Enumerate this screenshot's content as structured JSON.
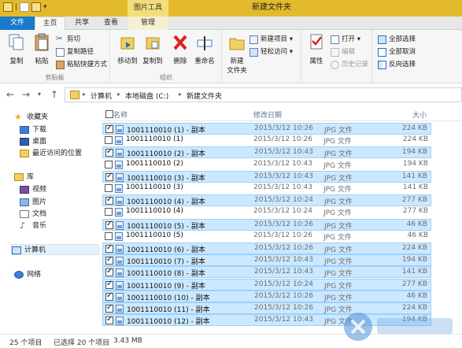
{
  "window": {
    "title": "新建文件夹",
    "context_tab_group": "图片工具"
  },
  "tabs": [
    {
      "label": "文件"
    },
    {
      "label": "主页"
    },
    {
      "label": "共享"
    },
    {
      "label": "查看"
    },
    {
      "label": "管理"
    }
  ],
  "ribbon": {
    "clipboard": {
      "label": "剪贴板",
      "copy": "复制",
      "paste": "粘贴",
      "cut": "剪切",
      "copy_path": "复制路径",
      "paste_shortcut": "粘贴快捷方式"
    },
    "organize": {
      "label": "组织",
      "move_to": "移动到",
      "copy_to": "复制到",
      "delete": "删除",
      "rename": "重命名"
    },
    "new": {
      "new_folder_line1": "新建",
      "new_folder_line2": "文件夹",
      "new_item": "新建项目 ▾",
      "easy_access": "轻松访问 ▾"
    },
    "open": {
      "properties": "属性",
      "open": "打开 ▾",
      "edit": "编辑",
      "history": "历史记录"
    },
    "select": {
      "select_all": "全部选择",
      "select_none": "全部取消",
      "invert": "反向选择"
    }
  },
  "address": {
    "crumbs": [
      "计算机",
      "本地磁盘 (C:)",
      "新建文件夹"
    ]
  },
  "nav": {
    "favorites": "收藏夹",
    "downloads": "下载",
    "desktop": "桌面",
    "recent": "最近访问的位置",
    "libraries": "库",
    "videos": "视频",
    "pictures": "图片",
    "documents": "文档",
    "music": "音乐",
    "computer": "计算机",
    "network": "网络"
  },
  "columns": {
    "name": "名称",
    "date": "修改日期",
    "size": "大小"
  },
  "files": [
    {
      "name": "1001110010 (1) - 副本",
      "date": "2015/3/12 10:26",
      "type": "JPG 文件",
      "size": "224 KB",
      "selected": true
    },
    {
      "name": "1001110010 (1)",
      "date": "2015/3/12 10:26",
      "type": "JPG 文件",
      "size": "224 KB",
      "selected": false
    },
    {
      "name": "1001110010 (2) - 副本",
      "date": "2015/3/12 10:43",
      "type": "JPG 文件",
      "size": "194 KB",
      "selected": true
    },
    {
      "name": "1001110010 (2)",
      "date": "2015/3/12 10:43",
      "type": "JPG 文件",
      "size": "194 KB",
      "selected": false
    },
    {
      "name": "1001110010 (3) - 副本",
      "date": "2015/3/12 10:43",
      "type": "JPG 文件",
      "size": "141 KB",
      "selected": true
    },
    {
      "name": "1001110010 (3)",
      "date": "2015/3/12 10:43",
      "type": "JPG 文件",
      "size": "141 KB",
      "selected": false
    },
    {
      "name": "1001110010 (4) - 副本",
      "date": "2015/3/12 10:24",
      "type": "JPG 文件",
      "size": "277 KB",
      "selected": true
    },
    {
      "name": "1001110010 (4)",
      "date": "2015/3/12 10:24",
      "type": "JPG 文件",
      "size": "277 KB",
      "selected": false
    },
    {
      "name": "1001110010 (5) - 副本",
      "date": "2015/3/12 10:26",
      "type": "JPG 文件",
      "size": "46 KB",
      "selected": true
    },
    {
      "name": "1001110010 (5)",
      "date": "2015/3/12 10:26",
      "type": "JPG 文件",
      "size": "46 KB",
      "selected": false
    },
    {
      "name": "1001110010 (6) - 副本",
      "date": "2015/3/12 10:26",
      "type": "JPG 文件",
      "size": "224 KB",
      "selected": true
    },
    {
      "name": "1001110010 (7) - 副本",
      "date": "2015/3/12 10:43",
      "type": "JPG 文件",
      "size": "194 KB",
      "selected": true
    },
    {
      "name": "1001110010 (8) - 副本",
      "date": "2015/3/12 10:43",
      "type": "JPG 文件",
      "size": "141 KB",
      "selected": true
    },
    {
      "name": "1001110010 (9) - 副本",
      "date": "2015/3/12 10:24",
      "type": "JPG 文件",
      "size": "277 KB",
      "selected": true
    },
    {
      "name": "1001110010 (10) - 副本",
      "date": "2015/3/12 10:26",
      "type": "JPG 文件",
      "size": "46 KB",
      "selected": true
    },
    {
      "name": "1001110010 (11) - 副本",
      "date": "2015/3/12 10:26",
      "type": "JPG 文件",
      "size": "224 KB",
      "selected": true
    },
    {
      "name": "1001110010 (12) - 副本",
      "date": "2015/3/12 10:43",
      "type": "JPG 文件",
      "size": "194 KB",
      "selected": true
    }
  ],
  "status": {
    "count": "25 个项目",
    "selection": "已选择 20 个项目",
    "size": "3.43 MB"
  }
}
